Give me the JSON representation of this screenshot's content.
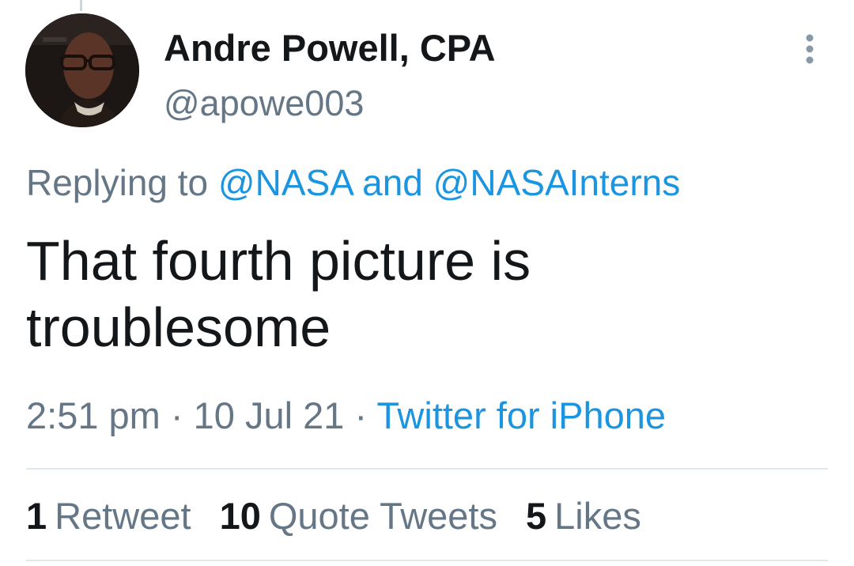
{
  "tweet": {
    "author": {
      "display_name": "Andre Powell, CPA",
      "handle": "@apowe003"
    },
    "reply": {
      "prefix": "Replying to",
      "mention_1": "@NASA",
      "joiner": "and",
      "mention_2": "@NASAInterns"
    },
    "text": "That fourth picture is troublesome",
    "meta": {
      "time": "2:51 pm",
      "separator": "·",
      "date": "10 Jul 21",
      "source": "Twitter for iPhone"
    },
    "stats": {
      "retweets": {
        "count": "1",
        "label": "Retweet"
      },
      "quotes": {
        "count": "10",
        "label": "Quote Tweets"
      },
      "likes": {
        "count": "5",
        "label": "Likes"
      }
    }
  },
  "icons": {
    "more": "more-vertical-icon"
  },
  "colors": {
    "text_primary": "#14171a",
    "text_secondary": "#657786",
    "link": "#1b95e0",
    "divider": "#e1e8ed"
  }
}
